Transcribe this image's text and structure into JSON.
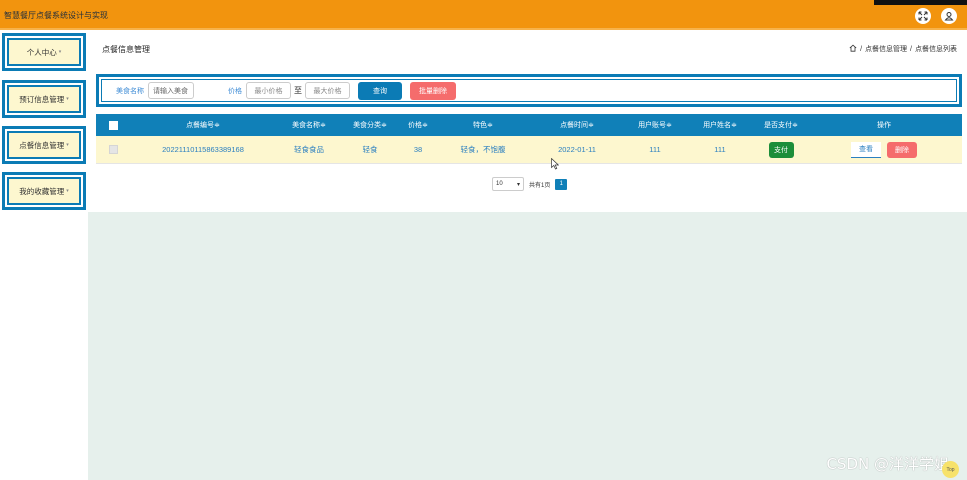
{
  "app": {
    "title": "智慧餐厅点餐系统设计与实现"
  },
  "topbar_icons": [
    "expand-icon",
    "user-icon"
  ],
  "sidebar": {
    "items": [
      {
        "label": "个人中心"
      },
      {
        "label": "预订信息管理"
      },
      {
        "label": "点餐信息管理"
      },
      {
        "label": "我的收藏管理"
      }
    ]
  },
  "page": {
    "title": "点餐信息管理",
    "breadcrumb": [
      "点餐信息管理",
      "点餐信息列表"
    ]
  },
  "search": {
    "food_label": "美食名称",
    "food_placeholder": "请输入美食",
    "price_label": "价格",
    "min_price_placeholder": "最小价格",
    "to": "至",
    "max_price_placeholder": "最大价格",
    "query_label": "查询",
    "batch_delete_label": "批量删除"
  },
  "table": {
    "headers": [
      "点餐编号",
      "美食名称",
      "美食分类",
      "价格",
      "特色",
      "点餐时间",
      "用户账号",
      "用户姓名",
      "是否支付",
      "操作"
    ],
    "sort_glyph": "≑",
    "rows": [
      {
        "order_no": "20221110115863389168",
        "food_name": "轻食食品",
        "category": "轻食",
        "price": "38",
        "feature": "轻食，不饱腹",
        "order_time": "2022-01-11",
        "user_account": "111",
        "user_name": "111",
        "pay_label": "支付",
        "view_label": "查看",
        "delete_label": "删除"
      }
    ]
  },
  "pagination": {
    "page_size": "10",
    "total": "共有1页",
    "current_page": "1"
  },
  "watermark": "CSDN @洋洋学姐",
  "back_to_top": "Top",
  "colors": {
    "topbar": "#f2940e",
    "primary": "#1080b8",
    "row_bg": "#fdf7cf",
    "danger": "#f56c6c",
    "success": "#1c8e3a",
    "content_bg": "#e6f0ec"
  }
}
